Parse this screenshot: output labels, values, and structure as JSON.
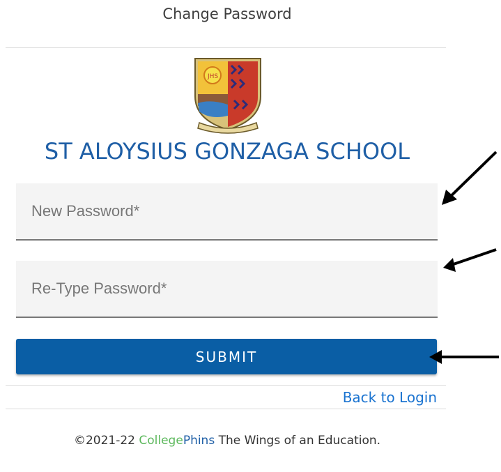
{
  "header": {
    "title": "Change Password"
  },
  "school": {
    "name": "ST ALOYSIUS GONZAGA SCHOOL",
    "crest_icon": "school-crest-icon",
    "crest_text": "JHS"
  },
  "form": {
    "new_password": {
      "placeholder": "New Password*",
      "value": ""
    },
    "retype_password": {
      "placeholder": "Re-Type Password*",
      "value": ""
    },
    "submit_label": "SUBMIT"
  },
  "links": {
    "back_to_login": "Back to Login"
  },
  "footer": {
    "copyright": "©2021-22 ",
    "brand_part1": "College",
    "brand_part2": "Phins",
    "tagline": " The Wings of an Education."
  },
  "colors": {
    "accent": "#1f5fa6",
    "button": "#0a5ea5",
    "link": "#1a73d0",
    "brand_green": "#5cb85c"
  },
  "annotations": {
    "arrow_icon": "arrow-pointer-icon"
  }
}
